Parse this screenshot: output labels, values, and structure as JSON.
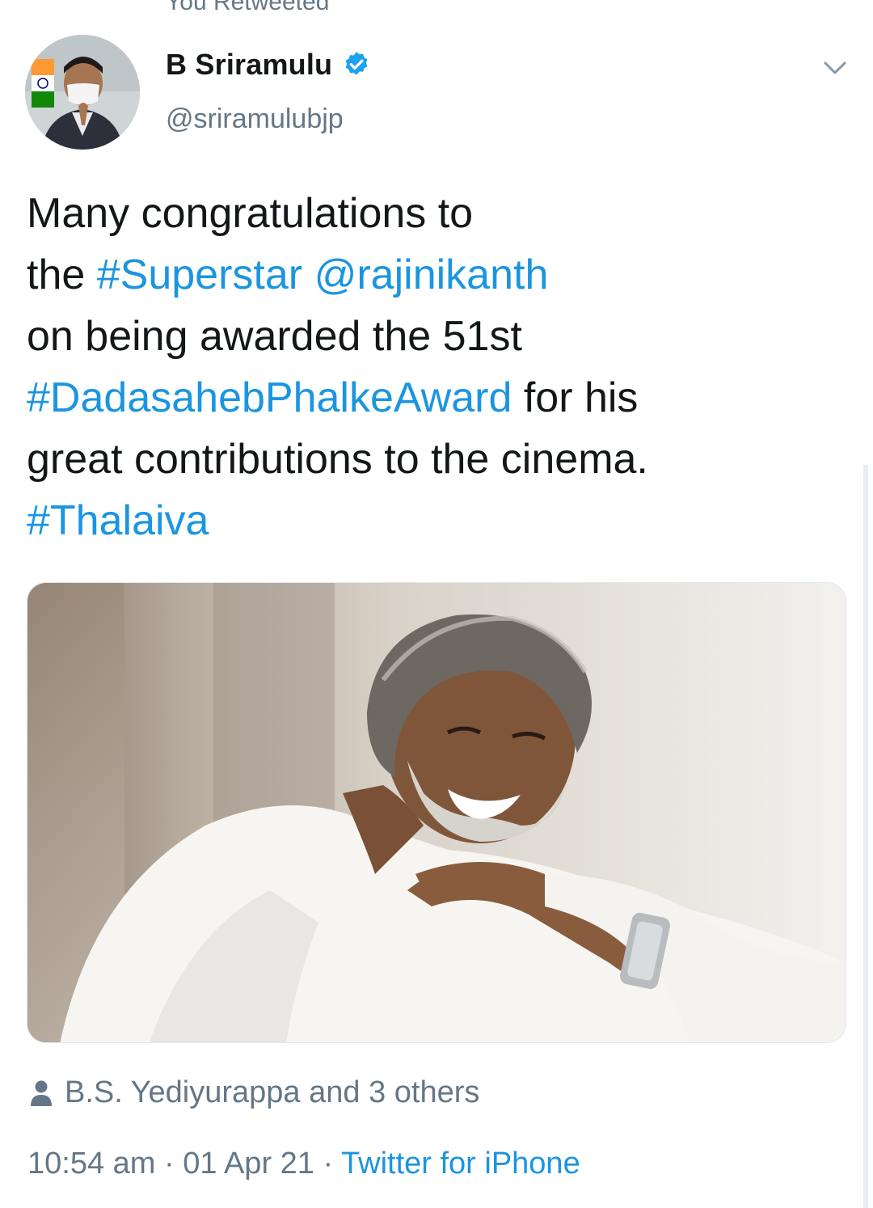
{
  "retweet_indicator": "You Retweeted",
  "author": {
    "display_name": "B Sriramulu",
    "handle": "@sriramulubjp",
    "verified": true,
    "avatar_icon": "profile-photo"
  },
  "tweet": {
    "lines": [
      [
        {
          "text": "Many congratulations to",
          "type": "text"
        }
      ],
      [
        {
          "text": "the ",
          "type": "text"
        },
        {
          "text": "#Superstar",
          "type": "hashtag"
        },
        {
          "text": " ",
          "type": "text"
        },
        {
          "text": "@rajinikanth",
          "type": "mention"
        }
      ],
      [
        {
          "text": "on being awarded the 51st",
          "type": "text"
        }
      ],
      [
        {
          "text": "#DadasahebPhalkeAward",
          "type": "hashtag"
        },
        {
          "text": " for his",
          "type": "text"
        }
      ],
      [
        {
          "text": "great contributions to the cinema.",
          "type": "text"
        }
      ],
      [
        {
          "text": "#Thalaiva",
          "type": "hashtag"
        }
      ]
    ]
  },
  "media": {
    "type": "photo",
    "icon": "tweet-photo"
  },
  "likes": {
    "icon": "person-icon",
    "text": "B.S. Yediyurappa and 3 others"
  },
  "meta": {
    "time": "10:54 am",
    "separator": " · ",
    "date": "01 Apr 21",
    "source": "Twitter for iPhone"
  },
  "colors": {
    "link": "#1b95e0",
    "secondary_text": "#657786",
    "primary_text": "#14171a",
    "verified_badge": "#1da1f2"
  }
}
